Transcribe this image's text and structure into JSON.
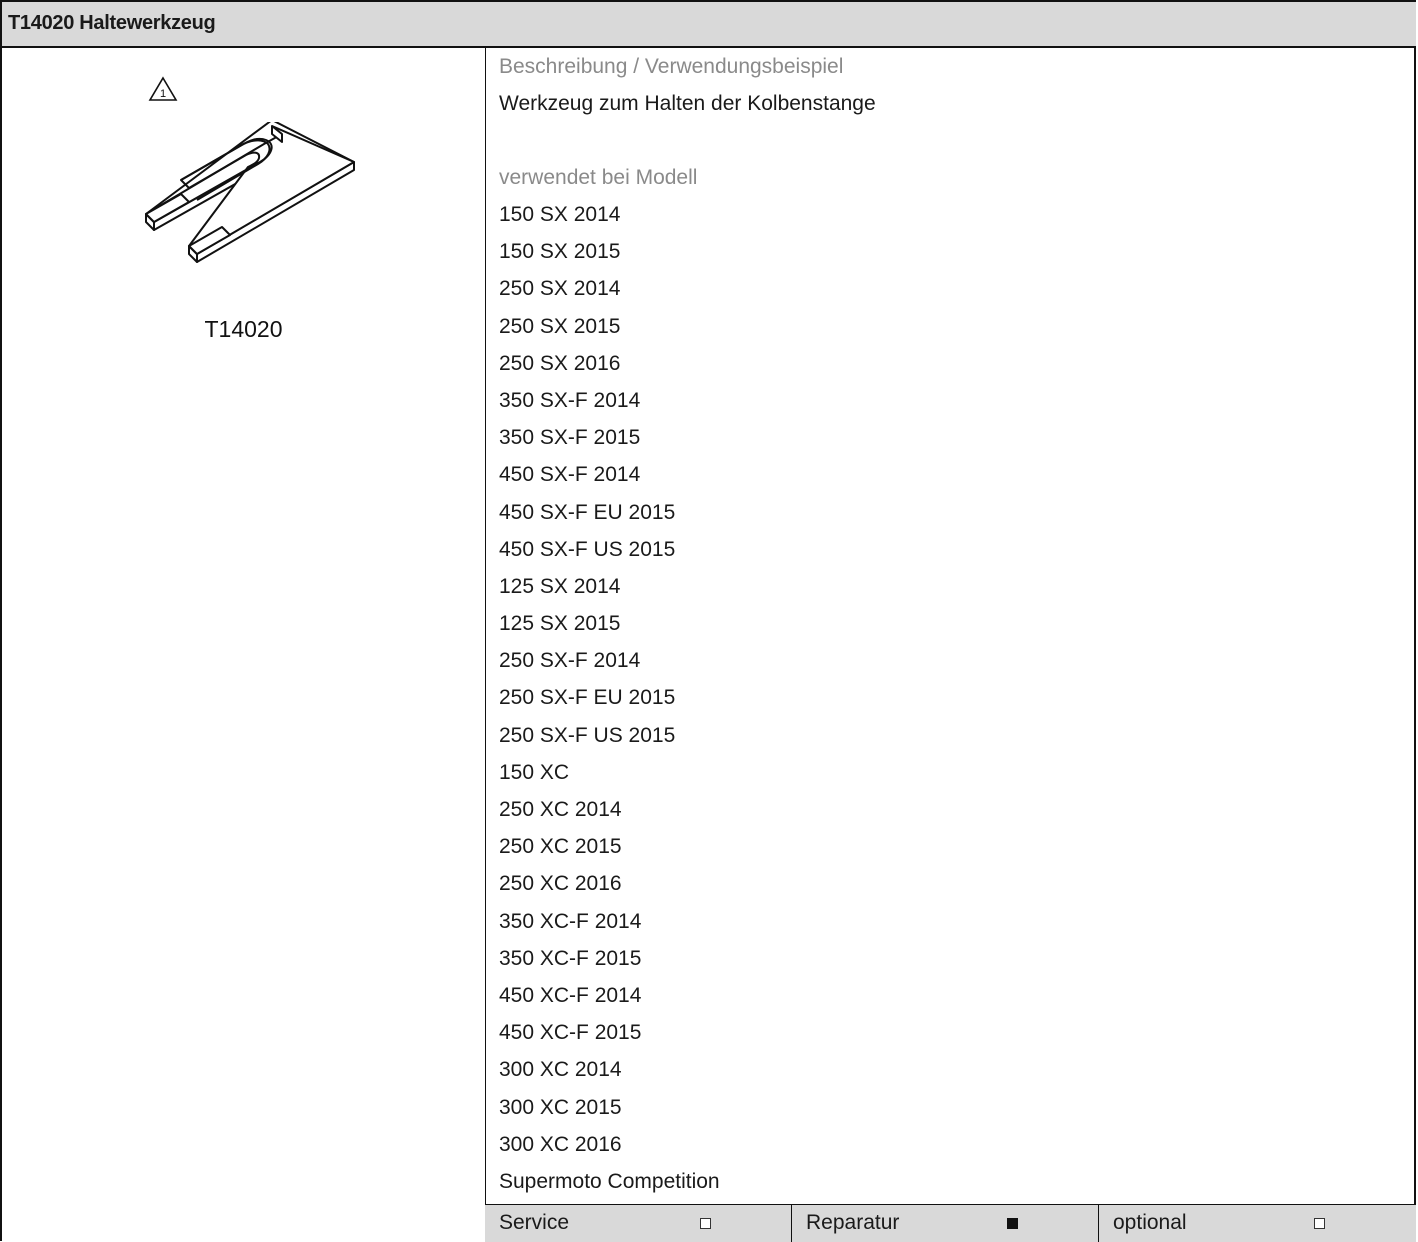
{
  "header": {
    "title": "T14020 Haltewerkzeug"
  },
  "tool": {
    "code": "T14020",
    "warning_icon": "warning-triangle-1-icon",
    "warning_number": "1"
  },
  "description": {
    "heading": "Beschreibung / Verwendungsbeispiel",
    "text": "Werkzeug zum Halten der Kolbenstange"
  },
  "models": {
    "heading": "verwendet bei Modell",
    "items": [
      "150 SX 2014",
      "150 SX 2015",
      "250 SX 2014",
      "250 SX 2015",
      "250 SX 2016",
      "350 SX-F 2014",
      "350 SX-F 2015",
      "450 SX-F 2014",
      "450 SX-F EU 2015",
      "450 SX-F US 2015",
      "125 SX 2014",
      "125 SX 2015",
      "250 SX-F 2014",
      "250 SX-F EU 2015",
      "250 SX-F US 2015",
      "150 XC",
      "250 XC 2014",
      "250 XC 2015",
      "250 XC 2016",
      "350 XC-F 2014",
      "350 XC-F 2015",
      "450 XC-F 2014",
      "450 XC-F 2015",
      "300 XC 2014",
      "300 XC 2015",
      "300 XC 2016",
      "Supermoto Competition"
    ]
  },
  "footer": [
    {
      "label": "Service",
      "checked": false
    },
    {
      "label": "Reparatur",
      "checked": true
    },
    {
      "label": "optional",
      "checked": false
    }
  ]
}
